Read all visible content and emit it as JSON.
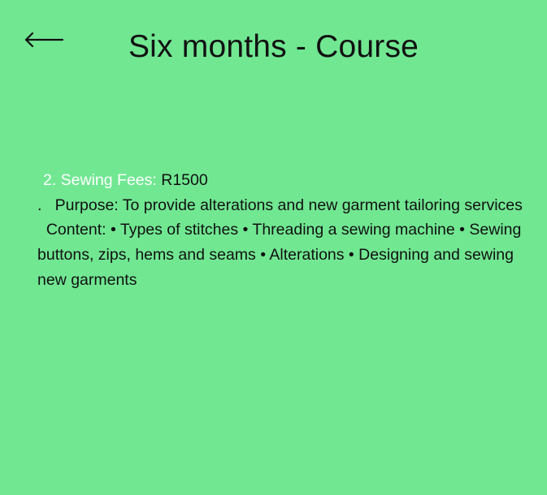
{
  "header": {
    "back_icon": "left-arrow-icon",
    "title": "Six months - Course"
  },
  "course": {
    "fee_label": "2. Sewing Fees:",
    "fee_value": "R1500",
    "purpose_lead": ".   ",
    "purpose_text": "Purpose: To provide alterations and new garment tailoring services",
    "content_lead": "  ",
    "content_text": "Content: • Types of stitches • Threading a sewing machine • Sewing buttons, zips, hems and seams • Alterations • Designing and sewing new garments"
  },
  "colors": {
    "background": "#71e792",
    "fee_label": "#ffffff",
    "text": "#111111"
  }
}
